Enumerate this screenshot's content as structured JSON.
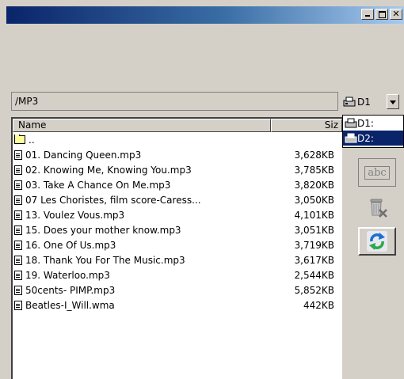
{
  "window": {
    "controls": [
      "minimize",
      "maximize",
      "close"
    ]
  },
  "path": "/MP3",
  "drive_selector": {
    "selected": "D1",
    "icon": "drive-icon"
  },
  "drive_options": [
    "D1:",
    "D2:"
  ],
  "columns": {
    "name": "Name",
    "size": "Siz"
  },
  "parent_dir": "..",
  "files": [
    {
      "name": "01. Dancing Queen.mp3",
      "size": "3,628KB"
    },
    {
      "name": "02. Knowing Me, Knowing You.mp3",
      "size": "3,785KB"
    },
    {
      "name": "03. Take A Chance On Me.mp3",
      "size": "3,820KB"
    },
    {
      "name": "07 Les Choristes, film score-Caress...",
      "size": "3,050KB"
    },
    {
      "name": "13. Voulez Vous.mp3",
      "size": "4,101KB"
    },
    {
      "name": "15. Does your mother know.mp3",
      "size": "3,051KB"
    },
    {
      "name": "16. One Of Us.mp3",
      "size": "3,719KB"
    },
    {
      "name": "18. Thank You For The Music.mp3",
      "size": "3,617KB"
    },
    {
      "name": "19. Waterloo.mp3",
      "size": "2,544KB"
    },
    {
      "name": "50cents- PIMP.mp3",
      "size": "5,852KB"
    },
    {
      "name": "Beatles-I_Will.wma",
      "size": "442KB"
    }
  ],
  "toolbar": {
    "rename_label": "abc",
    "icons": [
      "rename-icon",
      "delete-icon",
      "refresh-icon"
    ]
  },
  "colors": {
    "titlebar_start": "#0a246a",
    "titlebar_end": "#a6caf0",
    "selection": "#0a246a",
    "face": "#d4d0c8"
  }
}
